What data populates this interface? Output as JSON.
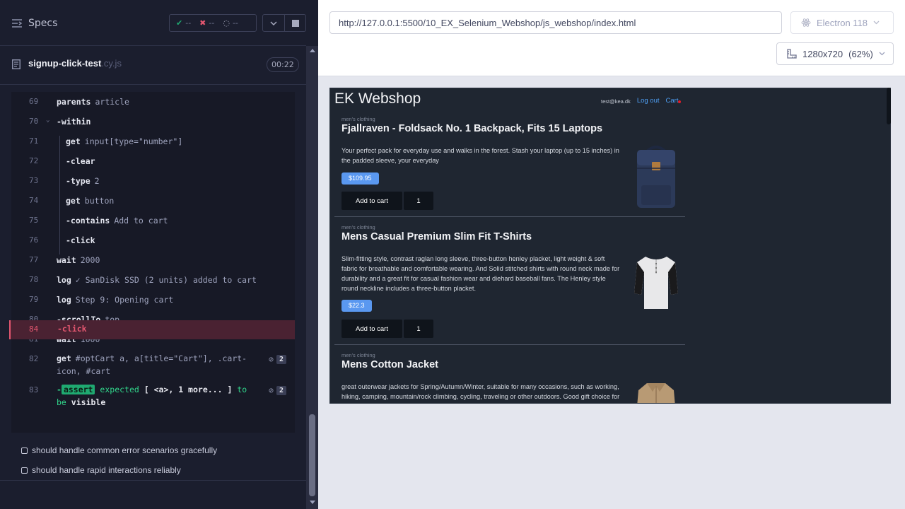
{
  "reporter": {
    "specs_label": "Specs",
    "stats": {
      "passed": "--",
      "failed": "--",
      "pending": "--"
    },
    "spec_name": "signup-click-test",
    "spec_ext": ".cy.js",
    "duration": "00:22",
    "commands": [
      {
        "num": "69",
        "name": "parents",
        "msg": "article"
      },
      {
        "num": "70",
        "name": "-within",
        "msg": ""
      },
      {
        "num": "71",
        "name": "get",
        "msg": "input[type=\"number\"]"
      },
      {
        "num": "72",
        "name": "-clear",
        "msg": ""
      },
      {
        "num": "73",
        "name": "-type",
        "msg": "2"
      },
      {
        "num": "74",
        "name": "get",
        "msg": "button"
      },
      {
        "num": "75",
        "name": "-contains",
        "msg": "Add to cart"
      },
      {
        "num": "76",
        "name": "-click",
        "msg": ""
      },
      {
        "num": "77",
        "name": "wait",
        "msg": "2000"
      },
      {
        "num": "78",
        "name": "log",
        "msg": "✓ SanDisk SSD (2 units) added to cart"
      },
      {
        "num": "79",
        "name": "log",
        "msg": "Step 9: Opening cart"
      },
      {
        "num": "80",
        "name": "-scrollTo",
        "msg": "top"
      },
      {
        "num": "81",
        "name": "wait",
        "msg": "1000"
      },
      {
        "num": "82",
        "name": "get",
        "msg_line1": "#optCart a, a[title=\"Cart\"], .cart-",
        "msg_line2": "icon, #cart",
        "count": "2"
      },
      {
        "num": "83",
        "name": "-",
        "assert": "assert",
        "assert_msg_a": "expected",
        "assert_msg_b": "[ <a>, 1 more... ]",
        "assert_msg_c": "to",
        "assert_line2_a": "be",
        "assert_line2_b": "visible",
        "count": "2"
      },
      {
        "num": "84",
        "name": "-click",
        "msg": ""
      }
    ],
    "tests": [
      "should handle common error scenarios gracefully",
      "should handle rapid interactions reliably"
    ]
  },
  "aut": {
    "url": "http://127.0.0.1:5500/10_EX_Selenium_Webshop/js_webshop/index.html",
    "browser": "Electron 118",
    "viewport": "1280x720",
    "scale": "(62%)"
  },
  "shop": {
    "logo": "EK Webshop",
    "email": "test@kea.dk",
    "logout": "Log out",
    "cart": "Cart",
    "products": [
      {
        "category": "men's clothing",
        "title": "Fjallraven - Foldsack No. 1 Backpack, Fits 15 Laptops",
        "description": "Your perfect pack for everyday use and walks in the forest. Stash your laptop (up to 15 inches) in the padded sleeve, your everyday",
        "price": "$109.95",
        "add_label": "Add to cart",
        "qty": "1"
      },
      {
        "category": "men's clothing",
        "title": "Mens Casual Premium Slim Fit T-Shirts",
        "description": "Slim-fitting style, contrast raglan long sleeve, three-button henley placket, light weight & soft fabric for breathable and comfortable wearing. And Solid stitched shirts with round neck made for durability and a great fit for casual fashion wear and diehard baseball fans. The Henley style round neckline includes a three-button placket.",
        "price": "$22.3",
        "add_label": "Add to cart",
        "qty": "1"
      },
      {
        "category": "men's clothing",
        "title": "Mens Cotton Jacket",
        "description": "great outerwear jackets for Spring/Autumn/Winter, suitable for many occasions, such as working, hiking, camping, mountain/rock climbing, cycling, traveling or other outdoors. Good gift choice for you or your family member. A warm hearted love to Father, husband or son in this thanksgiving or Christmas Day."
      }
    ]
  },
  "colors": {
    "pass": "#1fa971",
    "fail": "#e45770",
    "accent": "#5a98f0",
    "link": "#4e9ef2"
  }
}
